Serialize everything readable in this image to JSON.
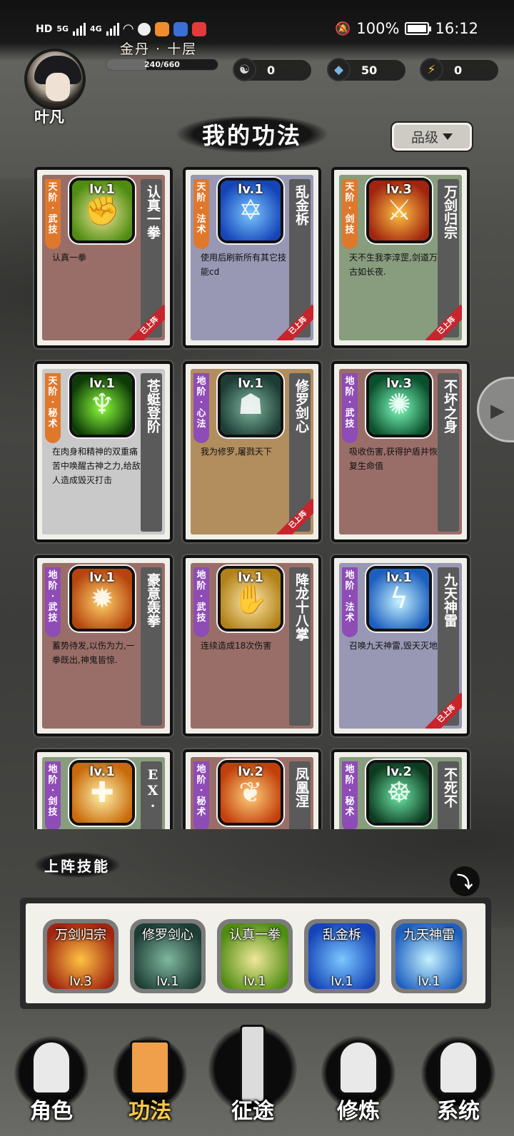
{
  "status_bar": {
    "network": "HD",
    "signal1": "5G",
    "signal2": "4G",
    "battery": "100%",
    "time": "16:12"
  },
  "player": {
    "name": "叶凡",
    "realm": "金丹 · 十层",
    "exp_text": "240/660",
    "exp_fraction": 0.36
  },
  "resources": [
    {
      "icon": "yin-yang-icon",
      "glyph": "☯",
      "value": "0",
      "color": "#d9d9d9"
    },
    {
      "icon": "spirit-stone-icon",
      "glyph": "◆",
      "value": "50",
      "color": "#74b6e6"
    },
    {
      "icon": "lightning-icon",
      "glyph": "⚡",
      "value": "0",
      "color": "#f2c33a"
    }
  ],
  "section": {
    "title": "我的功法",
    "filter_label": "品级"
  },
  "skills": [
    {
      "grade": "天阶·武技",
      "grade_color": "orange",
      "level": "lv.1",
      "name": "认真一拳",
      "desc": "认真一拳",
      "bg": "#9a6e68",
      "equipped": true,
      "art": [
        "#f0e89a",
        "#4f8c12"
      ],
      "glyph": "✊"
    },
    {
      "grade": "天阶·法术",
      "grade_color": "orange",
      "level": "lv.1",
      "name": "乱金柝",
      "desc": "使用后刷新所有其它技能cd",
      "bg": "#9898b5",
      "equipped": true,
      "art": [
        "#7bc8ff",
        "#1544b8"
      ],
      "glyph": "✡"
    },
    {
      "grade": "天阶·剑技",
      "grade_color": "orange",
      "level": "lv.3",
      "name": "万剑归宗",
      "desc": "天不生我李淳罡,剑道万古如长夜.",
      "bg": "#889c7e",
      "equipped": true,
      "art": [
        "#ffc243",
        "#a0240f"
      ],
      "glyph": "⚔"
    },
    {
      "grade": "天阶·秘术",
      "grade_color": "orange",
      "level": "lv.1",
      "name": "苍蜓登阶",
      "desc": "在肉身和精神的双重痛苦中唤醒古神之力,给敌人造成毁灭打击",
      "bg": "#c9c9c9",
      "equipped": false,
      "art": [
        "#8cff3e",
        "#0d3a06"
      ],
      "glyph": "♆"
    },
    {
      "grade": "地阶·心法",
      "grade_color": "purple",
      "level": "lv.1",
      "name": "修罗剑心",
      "desc": "我为修罗,屠戮天下",
      "bg": "#b28e5e",
      "equipped": true,
      "art": [
        "#7fb8a0",
        "#1d3c34"
      ],
      "glyph": "☗"
    },
    {
      "grade": "地阶·武技",
      "grade_color": "purple",
      "level": "lv.3",
      "name": "不坏之身",
      "desc": "吸收伤害,获得护盾并恢复生命值",
      "bg": "#9a6e68",
      "equipped": false,
      "art": [
        "#7effc0",
        "#0a4f2c"
      ],
      "glyph": "✺"
    },
    {
      "grade": "地阶·武技",
      "grade_color": "purple",
      "level": "lv.1",
      "name": "豪意轰拳",
      "desc": "蓄势待发,以伤为力,一拳既出,神鬼皆惊.",
      "bg": "#9a6e68",
      "equipped": false,
      "art": [
        "#ffd36a",
        "#b5440e"
      ],
      "glyph": "✹"
    },
    {
      "grade": "地阶·武技",
      "grade_color": "purple",
      "level": "lv.1",
      "name": "降龙十八掌",
      "desc": "连续造成18次伤害",
      "bg": "#9a6e68",
      "equipped": false,
      "art": [
        "#ffe9a8",
        "#b2821a"
      ],
      "glyph": "✋"
    },
    {
      "grade": "地阶·法术",
      "grade_color": "purple",
      "level": "lv.1",
      "name": "九天神雷",
      "desc": "召唤九天神雷,毁天灭地",
      "bg": "#9898b5",
      "equipped": true,
      "art": [
        "#c4f2ff",
        "#1d5fbf"
      ],
      "glyph": "ϟ"
    },
    {
      "grade": "地阶·剑技",
      "grade_color": "purple",
      "level": "lv.1",
      "name": "EX·",
      "desc": "",
      "bg": "#889c7e",
      "equipped": false,
      "art": [
        "#fff2a8",
        "#c96a0c"
      ],
      "glyph": "✚"
    },
    {
      "grade": "地阶·秘术",
      "grade_color": "purple",
      "level": "lv.2",
      "name": "凤凰涅",
      "desc": "",
      "bg": "#9a6e68",
      "equipped": false,
      "art": [
        "#ffd07a",
        "#c23f0b"
      ],
      "glyph": "❦"
    },
    {
      "grade": "地阶·秘术",
      "grade_color": "purple",
      "level": "lv.2",
      "name": "不死不",
      "desc": "",
      "bg": "#889c7e",
      "equipped": false,
      "art": [
        "#6fe8a8",
        "#0c3b20"
      ],
      "glyph": "☸"
    }
  ],
  "equipped_label": "已上阵",
  "equipped_section": {
    "title": "上阵技能",
    "slots": [
      {
        "name": "万剑归宗",
        "level": "lv.3",
        "art": [
          "#ffc243",
          "#a0240f"
        ]
      },
      {
        "name": "修罗剑心",
        "level": "lv.1",
        "art": [
          "#7fb8a0",
          "#1d3c34"
        ]
      },
      {
        "name": "认真一拳",
        "level": "lv.1",
        "art": [
          "#f0e89a",
          "#4f8c12"
        ]
      },
      {
        "name": "乱金柝",
        "level": "lv.1",
        "art": [
          "#7bc8ff",
          "#1544b8"
        ]
      },
      {
        "name": "九天神雷",
        "level": "lv.1",
        "art": [
          "#c4f2ff",
          "#1d5fbf"
        ]
      }
    ]
  },
  "nav": [
    {
      "label": "角色",
      "icon": "character-icon",
      "active": false
    },
    {
      "label": "功法",
      "icon": "skill-book-icon",
      "active": true
    },
    {
      "label": "征途",
      "icon": "sword-emblem-icon",
      "active": false
    },
    {
      "label": "修炼",
      "icon": "meditation-icon",
      "active": false
    },
    {
      "label": "系统",
      "icon": "system-icon",
      "active": false
    }
  ]
}
